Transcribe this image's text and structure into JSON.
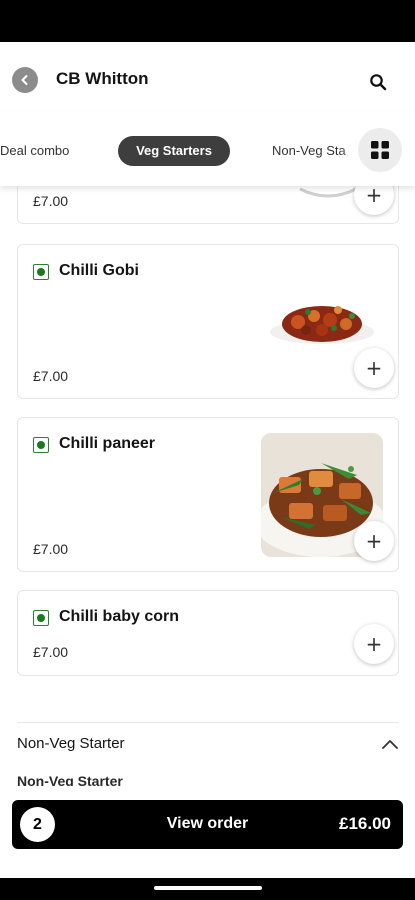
{
  "header": {
    "title": "CB Whitton",
    "back_icon": "chevron-left-icon",
    "search_icon": "search-icon"
  },
  "tabs": [
    {
      "label": "Deal combo",
      "active": false
    },
    {
      "label": "Veg Starters",
      "active": true
    },
    {
      "label": "Non-Veg Sta",
      "active": false
    }
  ],
  "grid_icon": "grid-icon",
  "items": [
    {
      "name": "",
      "price": "£7.00",
      "image": "dish-image"
    },
    {
      "name": "Chilli Gobi",
      "price": "£7.00",
      "image": "chilli-gobi-image",
      "veg": true
    },
    {
      "name": "Chilli paneer",
      "price": "£7.00",
      "image": "chilli-paneer-image",
      "veg": true
    },
    {
      "name": "Chilli baby corn",
      "price": "£7.00",
      "image": "",
      "veg": true
    }
  ],
  "section": {
    "title": "Non-Veg Starter",
    "subtitle": "Non-Veg Starter",
    "icon": "chevron-up-icon"
  },
  "order": {
    "count": "2",
    "label": "View order",
    "total": "£16.00"
  },
  "colors": {
    "veg_green": "#1b7a1f",
    "active_tab": "#3e3e3e",
    "order_button": "#000000"
  }
}
